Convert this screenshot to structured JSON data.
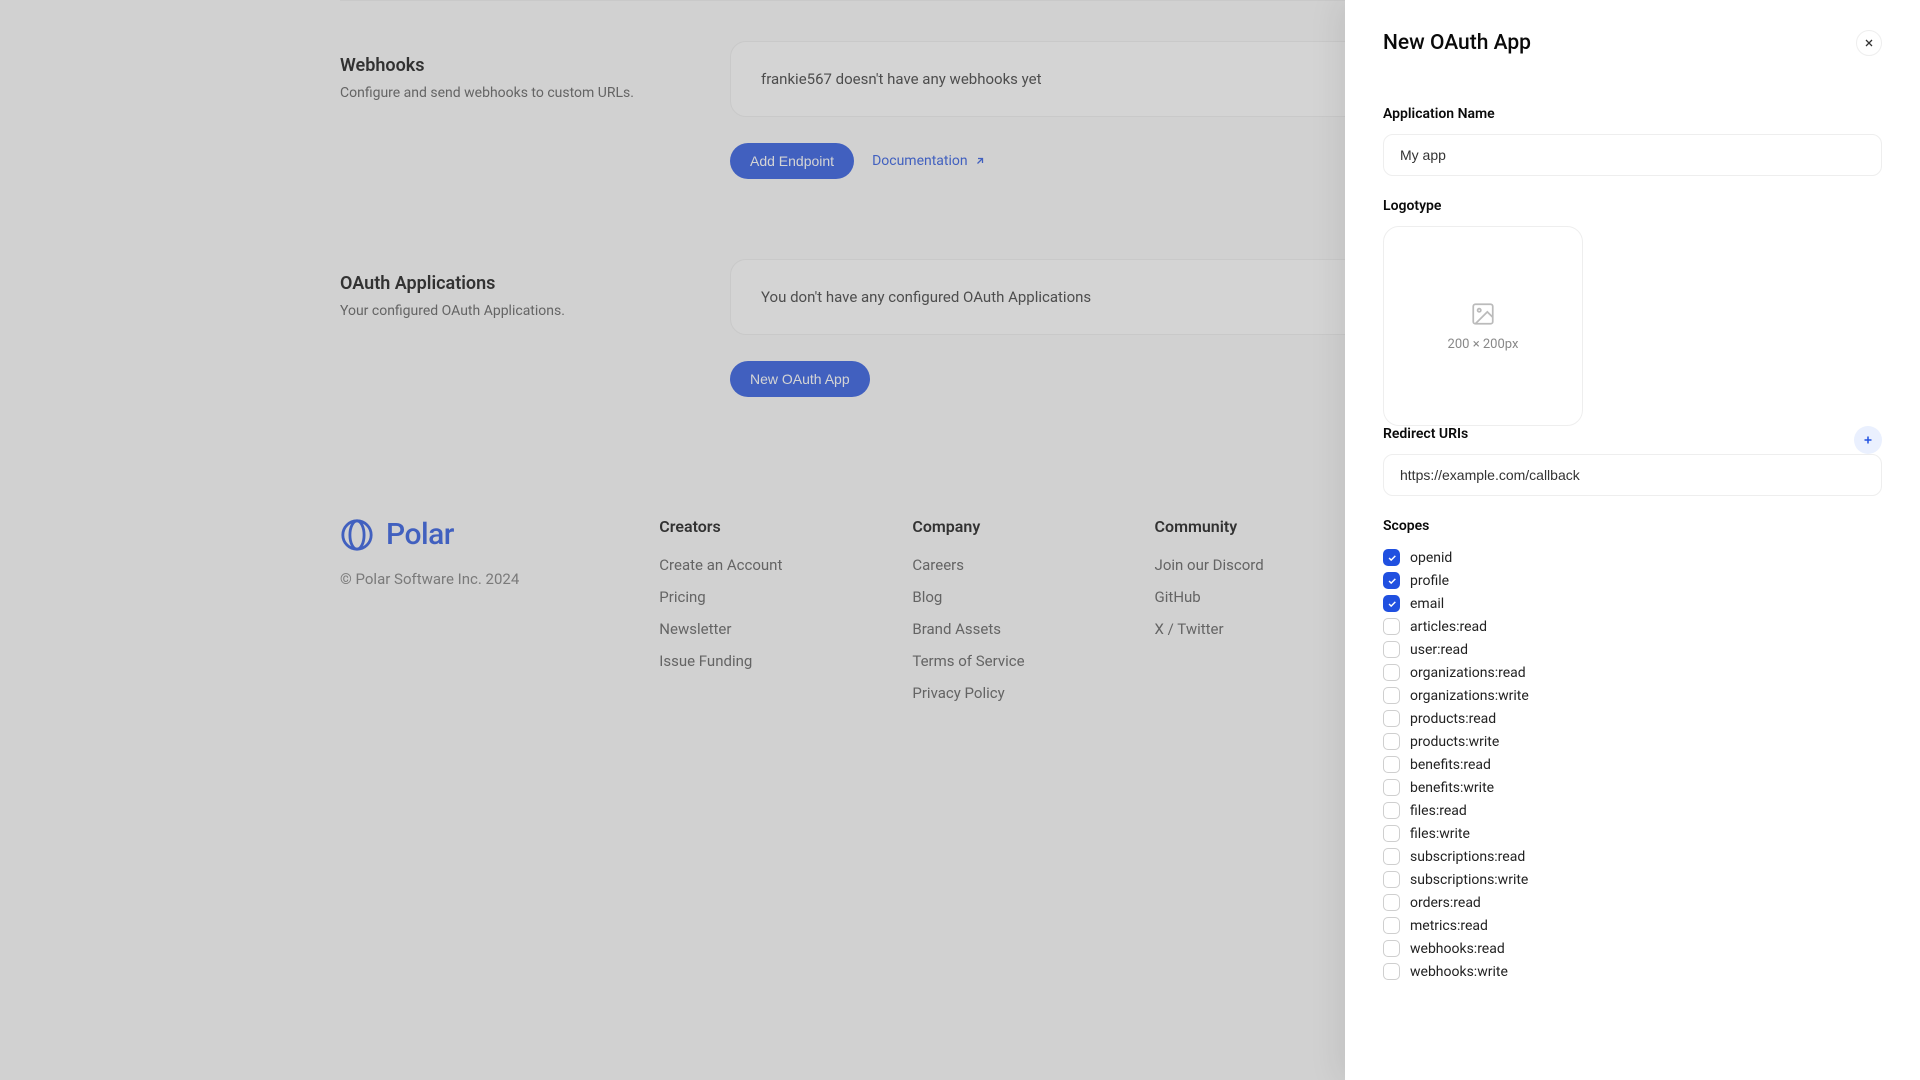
{
  "webhooks": {
    "title": "Webhooks",
    "subtitle": "Configure and send webhooks to custom URLs.",
    "empty": "frankie567 doesn't have any webhooks yet",
    "add": "Add Endpoint",
    "docs": "Documentation"
  },
  "oauth_section": {
    "title": "OAuth Applications",
    "subtitle": "Your configured OAuth Applications.",
    "empty": "You don't have any configured OAuth Applications",
    "new": "New OAuth App"
  },
  "footer": {
    "brand": "Polar",
    "copyright": "© Polar Software Inc. 2024",
    "cols": [
      {
        "title": "Creators",
        "links": [
          "Create an Account",
          "Pricing",
          "Newsletter",
          "Issue Funding"
        ]
      },
      {
        "title": "Company",
        "links": [
          "Careers",
          "Blog",
          "Brand Assets",
          "Terms of Service",
          "Privacy Policy"
        ]
      },
      {
        "title": "Community",
        "links": [
          "Join our Discord",
          "GitHub",
          "X / Twitter"
        ]
      }
    ]
  },
  "drawer": {
    "title": "New OAuth App",
    "app_name_label": "Application Name",
    "app_name_value": "My app",
    "logo_label": "Logotype",
    "logo_hint": "200 × 200px",
    "redirect_label": "Redirect URIs",
    "redirect_value": "https://example.com/callback",
    "scopes_label": "Scopes",
    "scopes": [
      {
        "label": "openid",
        "checked": true
      },
      {
        "label": "profile",
        "checked": true
      },
      {
        "label": "email",
        "checked": true
      },
      {
        "label": "articles:read",
        "checked": false
      },
      {
        "label": "user:read",
        "checked": false
      },
      {
        "label": "organizations:read",
        "checked": false
      },
      {
        "label": "organizations:write",
        "checked": false
      },
      {
        "label": "products:read",
        "checked": false
      },
      {
        "label": "products:write",
        "checked": false
      },
      {
        "label": "benefits:read",
        "checked": false
      },
      {
        "label": "benefits:write",
        "checked": false
      },
      {
        "label": "files:read",
        "checked": false
      },
      {
        "label": "files:write",
        "checked": false
      },
      {
        "label": "subscriptions:read",
        "checked": false
      },
      {
        "label": "subscriptions:write",
        "checked": false
      },
      {
        "label": "orders:read",
        "checked": false
      },
      {
        "label": "metrics:read",
        "checked": false
      },
      {
        "label": "webhooks:read",
        "checked": false
      },
      {
        "label": "webhooks:write",
        "checked": false
      }
    ]
  }
}
